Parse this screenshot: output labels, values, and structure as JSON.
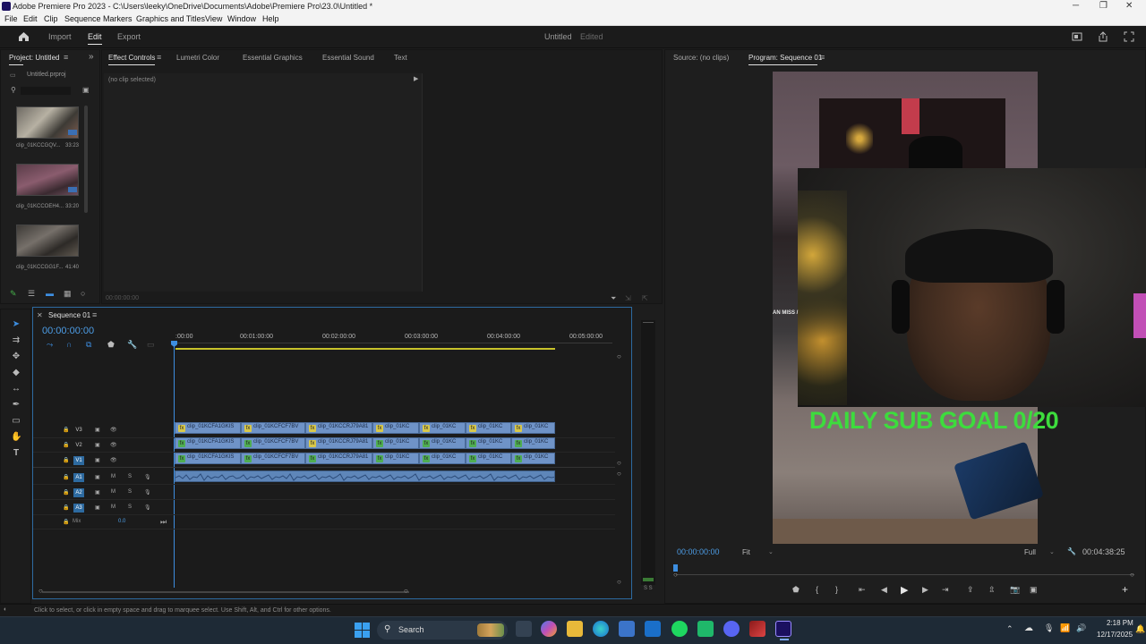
{
  "window": {
    "title": "Adobe Premiere Pro 2023 - C:\\Users\\leeky\\OneDrive\\Documents\\Adobe\\Premiere Pro\\23.0\\Untitled *"
  },
  "menu": [
    "File",
    "Edit",
    "Clip",
    "Sequence",
    "Markers",
    "Graphics and Titles",
    "View",
    "Window",
    "Help"
  ],
  "header": {
    "workspaces": [
      "Import",
      "Edit",
      "Export"
    ],
    "active_workspace": "Edit",
    "project_title": "Untitled",
    "project_status": "Edited"
  },
  "project_panel": {
    "title": "Project: Untitled",
    "file": "Untitled.prproj",
    "items": [
      {
        "name": "clip_01KCCGQV...",
        "duration": "33:23"
      },
      {
        "name": "clip_01KCCOEH4...",
        "duration": "33:20"
      },
      {
        "name": "clip_01KCCGG1F...",
        "duration": "41:40"
      }
    ]
  },
  "effect_controls": {
    "tabs": [
      "Effect Controls",
      "Lumetri Color",
      "Essential Graphics",
      "Essential Sound",
      "Text"
    ],
    "active_tab": "Effect Controls",
    "no_clip": "(no clip selected)",
    "timecode": "00:00:00:00"
  },
  "source_monitor": {
    "title": "Source: (no clips)"
  },
  "program_monitor": {
    "title": "Program: Sequence 01",
    "overlay_text": "DAILY SUB GOAL 0/20",
    "side_text": "AN MISS /",
    "timecode": "00:00:00:00",
    "fit": "Fit",
    "quality": "Full",
    "duration": "00:04:38:25"
  },
  "timeline": {
    "sequence_name": "Sequence 01",
    "timecode": "00:00:00:00",
    "ruler": [
      ":00:00",
      "00:01:00:00",
      "00:02:00:00",
      "00:03:00:00",
      "00:04:00:00",
      "00:05:00:00"
    ],
    "video_tracks": [
      "V3",
      "V2",
      "V1"
    ],
    "audio_tracks": [
      "A1",
      "A2",
      "A3"
    ],
    "mix_label": "Mix",
    "mix_value": "0.0",
    "track_buttons": {
      "mute": "M",
      "solo": "S"
    },
    "clip_rows": [
      [
        "clip_01KCFA1GKIS",
        "clip_01KCFCF7BV",
        "clip_01KCCRJ79A81",
        "clip_01KC",
        "clip_01KC",
        "clip_01KC",
        "clip_01KC"
      ],
      [
        "clip_01KCFA1GKIS",
        "clip_01KCFCF7BV",
        "clip_01KCCRJ79A81",
        "clip_01KC",
        "clip_01KC",
        "clip_01KC",
        "clip_01KC"
      ],
      [
        "clip_01KCFA1GKIS",
        "clip_01KCFCF7BV",
        "clip_01KCCRJ79A81",
        "clip_01KC",
        "clip_01KC",
        "clip_01KC",
        "clip_01KC"
      ]
    ],
    "meter_label": "S S"
  },
  "status_bar": "Click to select, or click in empty space and drag to marquee select. Use Shift, Alt, and Ctrl for other options.",
  "taskbar": {
    "search": "Search",
    "time": "2:18 PM",
    "date": "12/17/2025"
  },
  "colors": {
    "accent": "#2d8ceb",
    "timecode": "#4d9de6",
    "clip": "#6f93c7",
    "overlay_text": "#3ddc3d"
  }
}
